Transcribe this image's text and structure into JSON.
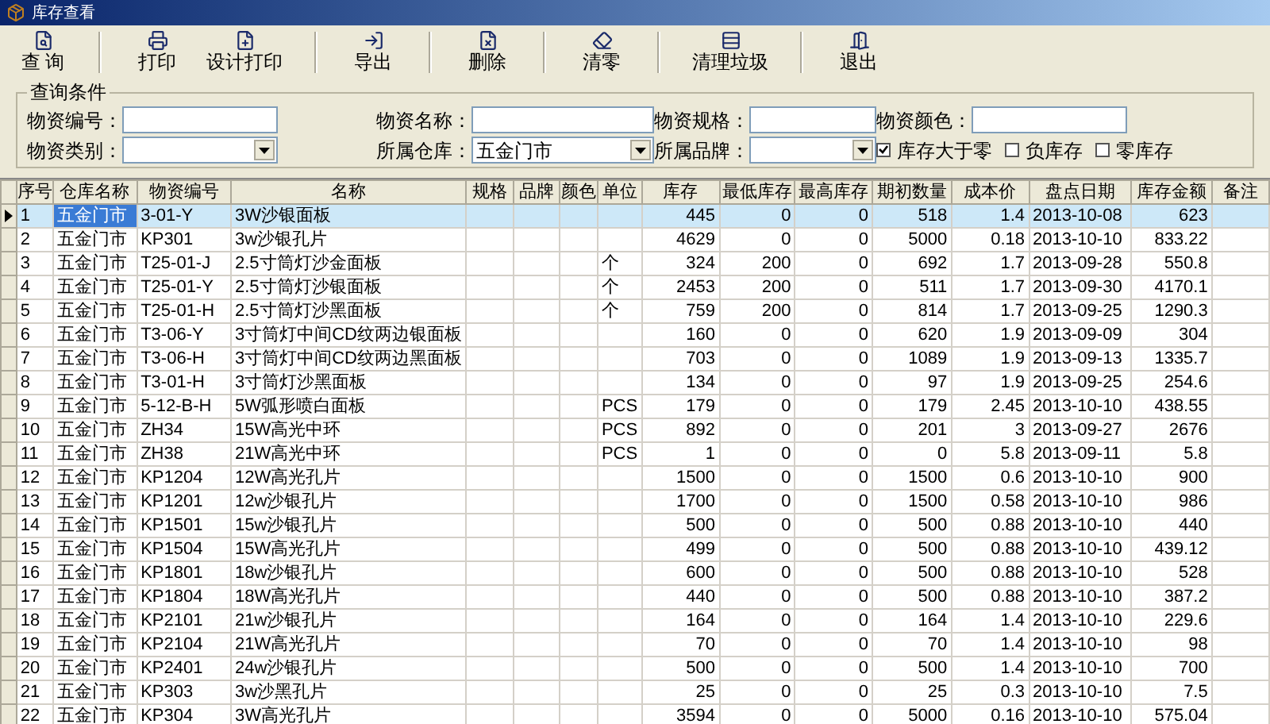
{
  "window": {
    "title": "库存查看"
  },
  "toolbar": [
    {
      "label": "查 询"
    },
    {
      "label": "打印"
    },
    {
      "label": "设计打印"
    },
    {
      "label": "导出"
    },
    {
      "label": "删除"
    },
    {
      "label": "清零"
    },
    {
      "label": "清理垃圾"
    },
    {
      "label": "退出"
    }
  ],
  "query": {
    "title": "查询条件",
    "fields": [
      {
        "label": "物资编号：",
        "kind": "text"
      },
      {
        "label": "物资名称：",
        "kind": "text"
      },
      {
        "label": "物资规格：",
        "kind": "text"
      },
      {
        "label": "物资颜色：",
        "kind": "text"
      },
      {
        "label": "物资类别：",
        "kind": "select"
      },
      {
        "label": "所属仓库：",
        "kind": "select",
        "value": "五金门市"
      },
      {
        "label": "所属品牌：",
        "kind": "select"
      }
    ],
    "checkboxes": [
      {
        "label": "库存大于零",
        "checked": true
      },
      {
        "label": "负库存",
        "checked": false
      },
      {
        "label": "零库存",
        "checked": false
      }
    ]
  },
  "table": {
    "columns": [
      "序号",
      "仓库名称",
      "物资编号",
      "名称",
      "规格",
      "品牌",
      "颜色",
      "单位",
      "库存",
      "最低库存",
      "最高库存",
      "期初数量",
      "成本价",
      "盘点日期",
      "库存金额",
      "备注"
    ],
    "rows": [
      {
        "selected": true,
        "cells": [
          "1",
          "五金门市",
          "3-01-Y",
          "3W沙银面板",
          "",
          "",
          "",
          "",
          "445",
          "0",
          "0",
          "518",
          "1.4",
          "2013-10-08",
          "623",
          ""
        ]
      },
      {
        "selected": false,
        "cells": [
          "2",
          "五金门市",
          "KP301",
          "3w沙银孔片",
          "",
          "",
          "",
          "",
          "4629",
          "0",
          "0",
          "5000",
          "0.18",
          "2013-10-10",
          "833.22",
          ""
        ]
      },
      {
        "selected": false,
        "cells": [
          "3",
          "五金门市",
          "T25-01-J",
          "2.5寸筒灯沙金面板",
          "",
          "",
          "",
          "个",
          "324",
          "200",
          "0",
          "692",
          "1.7",
          "2013-09-28",
          "550.8",
          ""
        ]
      },
      {
        "selected": false,
        "cells": [
          "4",
          "五金门市",
          "T25-01-Y",
          "2.5寸筒灯沙银面板",
          "",
          "",
          "",
          "个",
          "2453",
          "200",
          "0",
          "511",
          "1.7",
          "2013-09-30",
          "4170.1",
          ""
        ]
      },
      {
        "selected": false,
        "cells": [
          "5",
          "五金门市",
          "T25-01-H",
          "2.5寸筒灯沙黑面板",
          "",
          "",
          "",
          "个",
          "759",
          "200",
          "0",
          "814",
          "1.7",
          "2013-09-25",
          "1290.3",
          ""
        ]
      },
      {
        "selected": false,
        "cells": [
          "6",
          "五金门市",
          "T3-06-Y",
          "3寸筒灯中间CD纹两边银面板",
          "",
          "",
          "",
          "",
          "160",
          "0",
          "0",
          "620",
          "1.9",
          "2013-09-09",
          "304",
          ""
        ]
      },
      {
        "selected": false,
        "cells": [
          "7",
          "五金门市",
          "T3-06-H",
          "3寸筒灯中间CD纹两边黑面板",
          "",
          "",
          "",
          "",
          "703",
          "0",
          "0",
          "1089",
          "1.9",
          "2013-09-13",
          "1335.7",
          ""
        ]
      },
      {
        "selected": false,
        "cells": [
          "8",
          "五金门市",
          "T3-01-H",
          "3寸筒灯沙黑面板",
          "",
          "",
          "",
          "",
          "134",
          "0",
          "0",
          "97",
          "1.9",
          "2013-09-25",
          "254.6",
          ""
        ]
      },
      {
        "selected": false,
        "cells": [
          "9",
          "五金门市",
          "5-12-B-H",
          "5W弧形喷白面板",
          "",
          "",
          "",
          "PCS",
          "179",
          "0",
          "0",
          "179",
          "2.45",
          "2013-10-10",
          "438.55",
          ""
        ]
      },
      {
        "selected": false,
        "cells": [
          "10",
          "五金门市",
          "ZH34",
          "15W高光中环",
          "",
          "",
          "",
          "PCS",
          "892",
          "0",
          "0",
          "201",
          "3",
          "2013-09-27",
          "2676",
          ""
        ]
      },
      {
        "selected": false,
        "cells": [
          "11",
          "五金门市",
          "ZH38",
          "21W高光中环",
          "",
          "",
          "",
          "PCS",
          "1",
          "0",
          "0",
          "0",
          "5.8",
          "2013-09-11",
          "5.8",
          ""
        ]
      },
      {
        "selected": false,
        "cells": [
          "12",
          "五金门市",
          "KP1204",
          "12W高光孔片",
          "",
          "",
          "",
          "",
          "1500",
          "0",
          "0",
          "1500",
          "0.6",
          "2013-10-10",
          "900",
          ""
        ]
      },
      {
        "selected": false,
        "cells": [
          "13",
          "五金门市",
          "KP1201",
          "12w沙银孔片",
          "",
          "",
          "",
          "",
          "1700",
          "0",
          "0",
          "1500",
          "0.58",
          "2013-10-10",
          "986",
          ""
        ]
      },
      {
        "selected": false,
        "cells": [
          "14",
          "五金门市",
          "KP1501",
          "15w沙银孔片",
          "",
          "",
          "",
          "",
          "500",
          "0",
          "0",
          "500",
          "0.88",
          "2013-10-10",
          "440",
          ""
        ]
      },
      {
        "selected": false,
        "cells": [
          "15",
          "五金门市",
          "KP1504",
          "15W高光孔片",
          "",
          "",
          "",
          "",
          "499",
          "0",
          "0",
          "500",
          "0.88",
          "2013-10-10",
          "439.12",
          ""
        ]
      },
      {
        "selected": false,
        "cells": [
          "16",
          "五金门市",
          "KP1801",
          "18w沙银孔片",
          "",
          "",
          "",
          "",
          "600",
          "0",
          "0",
          "500",
          "0.88",
          "2013-10-10",
          "528",
          ""
        ]
      },
      {
        "selected": false,
        "cells": [
          "17",
          "五金门市",
          "KP1804",
          "18W高光孔片",
          "",
          "",
          "",
          "",
          "440",
          "0",
          "0",
          "500",
          "0.88",
          "2013-10-10",
          "387.2",
          ""
        ]
      },
      {
        "selected": false,
        "cells": [
          "18",
          "五金门市",
          "KP2101",
          "21w沙银孔片",
          "",
          "",
          "",
          "",
          "164",
          "0",
          "0",
          "164",
          "1.4",
          "2013-10-10",
          "229.6",
          ""
        ]
      },
      {
        "selected": false,
        "cells": [
          "19",
          "五金门市",
          "KP2104",
          "21W高光孔片",
          "",
          "",
          "",
          "",
          "70",
          "0",
          "0",
          "70",
          "1.4",
          "2013-10-10",
          "98",
          ""
        ]
      },
      {
        "selected": false,
        "cells": [
          "20",
          "五金门市",
          "KP2401",
          "24w沙银孔片",
          "",
          "",
          "",
          "",
          "500",
          "0",
          "0",
          "500",
          "1.4",
          "2013-10-10",
          "700",
          ""
        ]
      },
      {
        "selected": false,
        "cells": [
          "21",
          "五金门市",
          "KP303",
          "3w沙黑孔片",
          "",
          "",
          "",
          "",
          "25",
          "0",
          "0",
          "25",
          "0.3",
          "2013-10-10",
          "7.5",
          ""
        ]
      },
      {
        "selected": false,
        "cells": [
          "22",
          "五金门市",
          "KP304",
          "3W高光孔片",
          "",
          "",
          "",
          "",
          "3594",
          "0",
          "0",
          "5000",
          "0.16",
          "2013-10-10",
          "575.04",
          ""
        ]
      }
    ]
  }
}
